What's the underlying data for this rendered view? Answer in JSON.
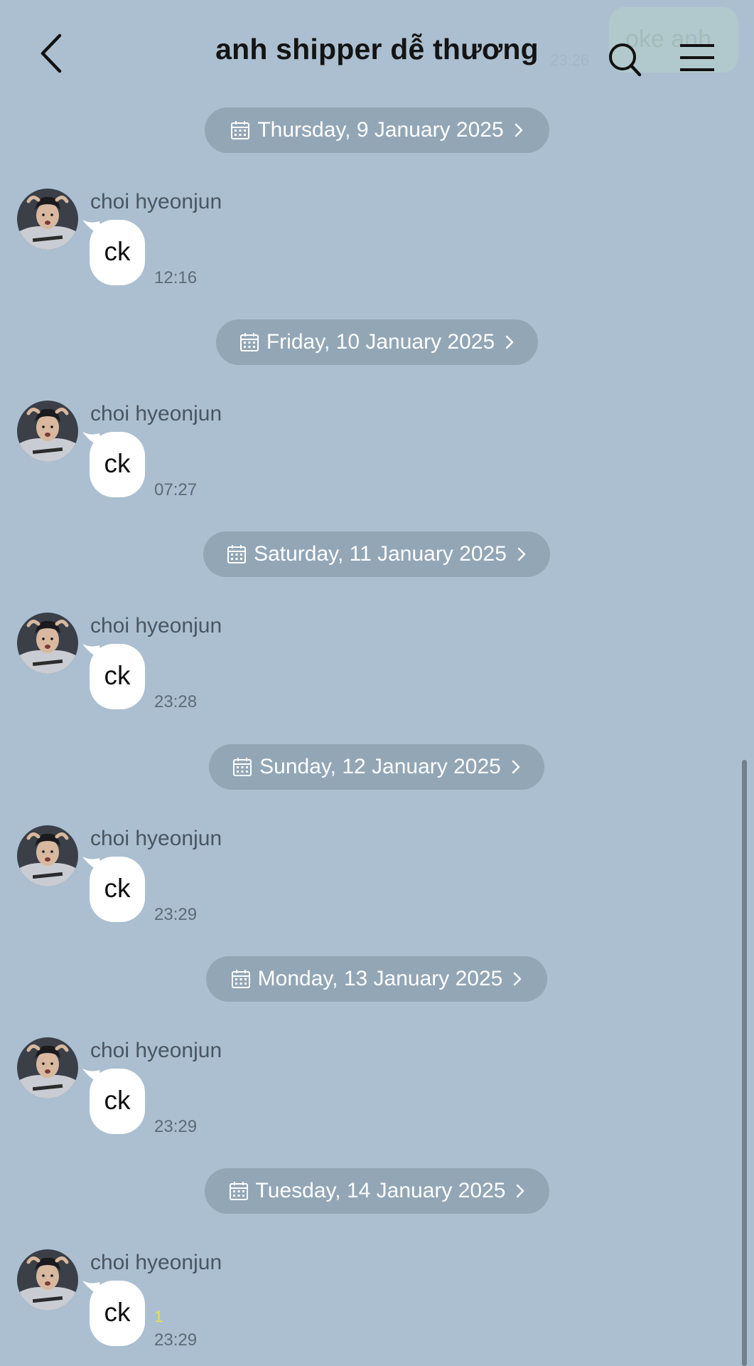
{
  "header": {
    "title": "anh shipper dễ thương",
    "ghost_bubble_text": "oke anh",
    "ghost_time": "23:26"
  },
  "sections": [
    {
      "date": "Thursday, 9 January 2025",
      "sender": "choi hyeonjun",
      "message": "ck",
      "time": "12:16"
    },
    {
      "date": "Friday, 10 January 2025",
      "sender": "choi hyeonjun",
      "message": "ck",
      "time": "07:27"
    },
    {
      "date": "Saturday, 11 January 2025",
      "sender": "choi hyeonjun",
      "message": "ck",
      "time": "23:28"
    },
    {
      "date": "Sunday, 12 January 2025",
      "sender": "choi hyeonjun",
      "message": "ck",
      "time": "23:29"
    },
    {
      "date": "Monday, 13 January 2025",
      "sender": "choi hyeonjun",
      "message": "ck",
      "time": "23:29"
    },
    {
      "date": "Tuesday, 14 January 2025",
      "sender": "choi hyeonjun",
      "message": "ck",
      "time": "23:29",
      "unread": "1"
    }
  ],
  "icons": {
    "back": "chevron-left-icon",
    "search": "search-icon",
    "menu": "hamburger-menu-icon",
    "date": "calendar-icon",
    "date_arrow": "chevron-right-icon"
  },
  "colors": {
    "background": "#abbfd0",
    "date_pill": "#92a6b6",
    "bubble": "#ffffff",
    "unread_count": "#e8e24a"
  }
}
